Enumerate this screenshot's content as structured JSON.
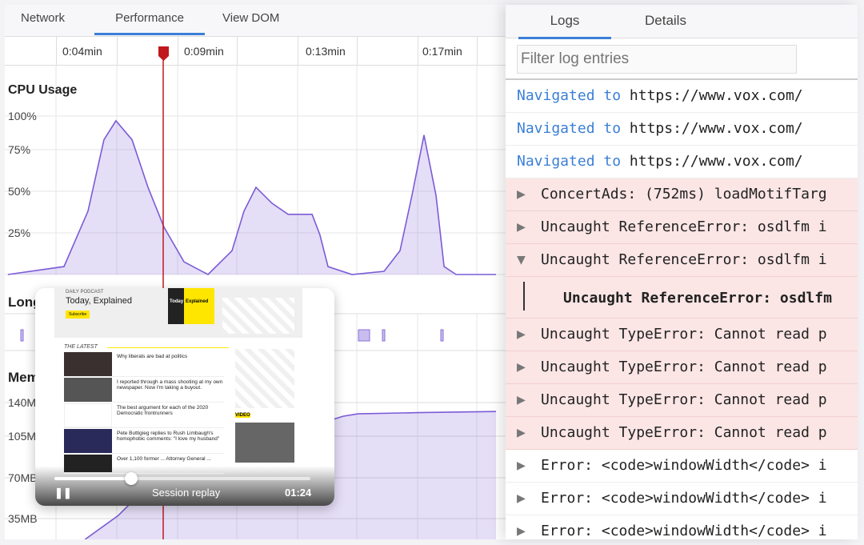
{
  "left_tabs": [
    {
      "label": "Network"
    },
    {
      "label": "Performance",
      "active": true
    },
    {
      "label": "View DOM"
    }
  ],
  "timeline_ticks": [
    "0:04min",
    "0:09min",
    "0:13min",
    "0:17min"
  ],
  "cpu": {
    "title": "CPU Usage",
    "y_labels": [
      "100%",
      "75%",
      "50%",
      "25%"
    ]
  },
  "long_tasks": {
    "title": "Long"
  },
  "memory": {
    "title": "Mem",
    "y_labels": [
      "140M",
      "105M",
      "70MB",
      "35MB"
    ]
  },
  "chart_data": [
    {
      "type": "area",
      "title": "CPU Usage",
      "ylabel": "",
      "ylim": [
        0,
        100
      ],
      "x_unit": "min",
      "color": "#7b5cd6",
      "x": [
        1.33,
        3.2,
        4,
        4.53,
        4.93,
        5.47,
        6.0,
        6.53,
        7.2,
        8,
        8.8,
        9.2,
        9.6,
        10.13,
        10.67,
        11.47,
        11.73,
        12,
        12.8,
        13.87,
        14.4,
        14.8,
        15.2,
        15.6,
        15.87,
        16.27,
        17.6
      ],
      "y": [
        0,
        5,
        40,
        85,
        97,
        85,
        55,
        30,
        8,
        0,
        15,
        40,
        55,
        45,
        38,
        38,
        25,
        5,
        0,
        2,
        15,
        50,
        88,
        50,
        5,
        0,
        0
      ]
    },
    {
      "type": "area",
      "title": "Memory",
      "ylim": [
        0,
        160
      ],
      "y_unit": "MB",
      "color": "#7b5cd6",
      "x": [
        3.9,
        5,
        6,
        8,
        10,
        12,
        12.5,
        13,
        15,
        17.6
      ],
      "y": [
        0,
        20,
        45,
        70,
        90,
        100,
        104,
        106,
        107,
        108
      ]
    }
  ],
  "replay": {
    "podcast_label": "DAILY PODCAST",
    "podcast_title": "Today, Explained",
    "subscribe": "Subscribe",
    "cover_text_1": "Today",
    "cover_text_2": "Explained",
    "section": "THE LATEST",
    "video_label": "VIDEO",
    "articles": [
      "Why liberals are bad at politics",
      "I reported through a mass shooting at my own newspaper. Now I'm taking a buyout.",
      "The best argument for each of the 2020 Democratic frontrunners",
      "Pete Buttigieg replies to Rush Limbaugh's homophobic comments: \"I love my husband\"",
      "Over 1,100 former ... Attorney General ..."
    ],
    "label": "Session replay",
    "time": "01:24",
    "progress": 0.3
  },
  "right_tabs": [
    {
      "label": "Logs",
      "active": true
    },
    {
      "label": "Details"
    }
  ],
  "filter_placeholder": "Filter log entries",
  "logs": [
    {
      "type": "nav",
      "prefix": "Navigated to",
      "text": "https://www.vox.com/"
    },
    {
      "type": "nav",
      "prefix": "Navigated to",
      "text": "https://www.vox.com/"
    },
    {
      "type": "nav",
      "prefix": "Navigated to",
      "text": "https://www.vox.com/"
    },
    {
      "type": "err",
      "icon": "triangle-right-icon",
      "text": "ConcertAds: (752ms) loadMotifTarg"
    },
    {
      "type": "err",
      "icon": "triangle-right-icon",
      "text": "Uncaught ReferenceError: osdlfm i"
    },
    {
      "type": "err",
      "icon": "triangle-down-icon",
      "text": "Uncaught ReferenceError: osdlfm i"
    },
    {
      "type": "sub",
      "text": "Uncaught ReferenceError: osdlfm"
    },
    {
      "type": "err",
      "icon": "triangle-right-icon",
      "text": "Uncaught TypeError: Cannot read p"
    },
    {
      "type": "err",
      "icon": "triangle-right-icon",
      "text": "Uncaught TypeError: Cannot read p"
    },
    {
      "type": "err",
      "icon": "triangle-right-icon",
      "text": "Uncaught TypeError: Cannot read p"
    },
    {
      "type": "err",
      "icon": "triangle-right-icon",
      "text": "Uncaught TypeError: Cannot read p"
    },
    {
      "type": "info",
      "icon": "triangle-right-icon",
      "text": "Error: <code>windowWidth</code> i"
    },
    {
      "type": "info",
      "icon": "triangle-right-icon",
      "text": "Error: <code>windowWidth</code> i"
    },
    {
      "type": "info",
      "icon": "triangle-right-icon",
      "text": "Error: <code>windowWidth</code> i"
    }
  ]
}
